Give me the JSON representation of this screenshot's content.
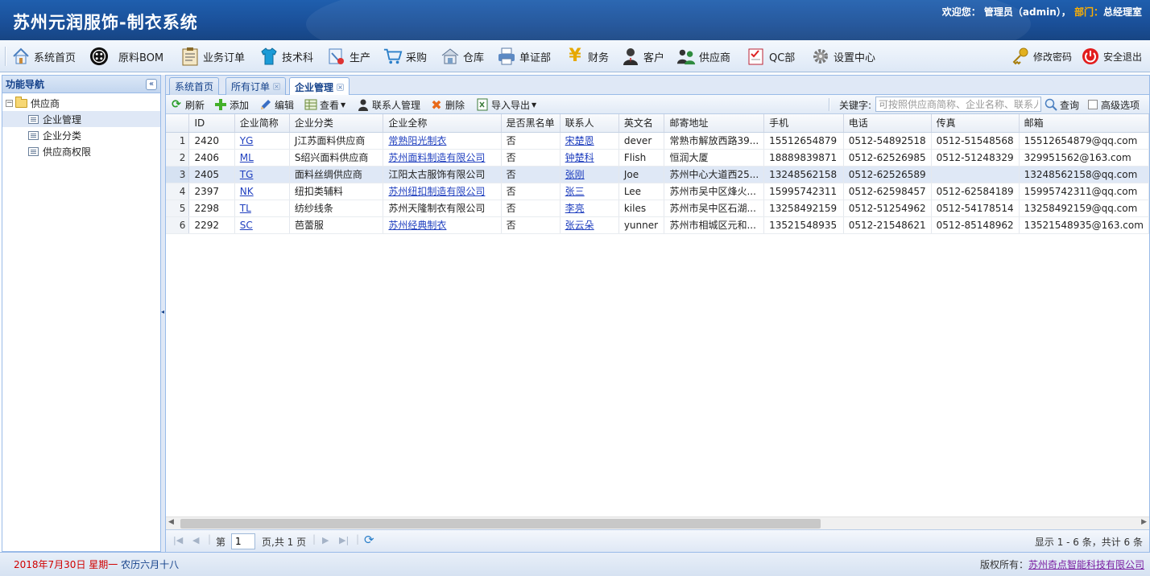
{
  "app": {
    "title": "苏州元润服饰-制衣系统",
    "welcome_prefix": "欢迎您：",
    "user": "管理员（admin），",
    "dept_label": "部门：",
    "dept": "总经理室"
  },
  "menu": {
    "items": [
      {
        "label": "系统首页",
        "icon": "home-icon"
      },
      {
        "label": "原料BOM",
        "icon": "button-icon"
      },
      {
        "label": "业务订单",
        "icon": "clipboard-icon"
      },
      {
        "label": "技术科",
        "icon": "shirt-icon"
      },
      {
        "label": "生产",
        "icon": "tools-icon"
      },
      {
        "label": "采购",
        "icon": "cart-icon"
      },
      {
        "label": "仓库",
        "icon": "warehouse-icon"
      },
      {
        "label": "单证部",
        "icon": "printer-icon"
      },
      {
        "label": "财务",
        "icon": "yen-icon"
      },
      {
        "label": "客户",
        "icon": "user-icon"
      },
      {
        "label": "供应商",
        "icon": "users-icon"
      },
      {
        "label": "QC部",
        "icon": "checklist-icon"
      },
      {
        "label": "设置中心",
        "icon": "gear-icon"
      }
    ],
    "change_password": "修改密码",
    "logout": "安全退出"
  },
  "nav": {
    "title": "功能导航",
    "root": "供应商",
    "items": [
      "企业管理",
      "企业分类",
      "供应商权限"
    ]
  },
  "tabs": [
    "系统首页",
    "所有订单",
    "企业管理"
  ],
  "toolbar": {
    "refresh": "刷新",
    "add": "添加",
    "edit": "编辑",
    "view": "查看",
    "contacts": "联系人管理",
    "delete": "删除",
    "import_export": "导入导出",
    "keyword_label": "关键字:",
    "search_placeholder": "可按照供应商简称、企业名称、联系人",
    "query": "查询",
    "advanced": "高级选项"
  },
  "grid": {
    "columns": [
      "ID",
      "企业简称",
      "企业分类",
      "企业全称",
      "是否黑名单",
      "联系人",
      "英文名",
      "邮寄地址",
      "手机",
      "电话",
      "传真",
      "邮箱"
    ],
    "rows": [
      {
        "n": "1",
        "id": "2420",
        "abbr": "YG",
        "category": "J江苏面料供应商",
        "full": "常熟阳光制衣",
        "full_link": true,
        "blacklist": "否",
        "contact": "宋楚恩",
        "en": "dever",
        "addr": "常熟市解放西路39...",
        "mobile": "15512654879",
        "phone": "0512-54892518",
        "fax": "0512-51548568",
        "email": "15512654879@qq.com"
      },
      {
        "n": "2",
        "id": "2406",
        "abbr": "ML",
        "category": "S绍兴面料供应商",
        "full": "苏州面料制造有限公司",
        "full_link": true,
        "blacklist": "否",
        "contact": "钟楚科",
        "en": "Flish",
        "addr": "恒润大厦",
        "mobile": "18889839871",
        "phone": "0512-62526985",
        "fax": "0512-51248329",
        "email": "329951562@163.com"
      },
      {
        "n": "3",
        "id": "2405",
        "abbr": "TG",
        "category": "面料丝绸供应商",
        "full": "江阳太古服饰有限公司",
        "full_link": false,
        "blacklist": "否",
        "contact": "张刚",
        "en": "Joe",
        "addr": "苏州中心大道西25...",
        "mobile": "13248562158",
        "phone": "0512-62526589",
        "fax": "",
        "email": "13248562158@qq.com"
      },
      {
        "n": "4",
        "id": "2397",
        "abbr": "NK",
        "category": "纽扣类辅料",
        "full": "苏州纽扣制造有限公司",
        "full_link": true,
        "blacklist": "否",
        "contact": "张三",
        "en": "Lee",
        "addr": "苏州市吴中区烽火...",
        "mobile": "15995742311",
        "phone": "0512-62598457",
        "fax": "0512-62584189",
        "email": "15995742311@qq.com"
      },
      {
        "n": "5",
        "id": "2298",
        "abbr": "TL",
        "category": "纺纱线条",
        "full": "苏州天隆制衣有限公司",
        "full_link": false,
        "blacklist": "否",
        "contact": "李亮",
        "en": "kiles",
        "addr": "苏州市吴中区石湖...",
        "mobile": "13258492159",
        "phone": "0512-51254962",
        "fax": "0512-54178514",
        "email": "13258492159@qq.com"
      },
      {
        "n": "6",
        "id": "2292",
        "abbr": "SC",
        "category": "芭蕾服",
        "full": "苏州经典制衣",
        "full_link": true,
        "blacklist": "否",
        "contact": "张云朵",
        "en": "yunner",
        "addr": "苏州市相城区元和...",
        "mobile": "13521548935",
        "phone": "0512-21548621",
        "fax": "0512-85148962",
        "email": "13521548935@163.com"
      }
    ]
  },
  "pager": {
    "page_prefix": "第",
    "page_value": "1",
    "page_suffix": "页,共 1 页",
    "summary": "显示 1 - 6 条，共计 6 条"
  },
  "footer": {
    "date": "2018年7月30日 星期一",
    "lunar": "农历六月十八",
    "copyright_label": "版权所有：",
    "company": "苏州奇点智能科技有限公司"
  },
  "colors": {
    "header_bg": "#1a4f98",
    "dept_label": "#ffb000",
    "selected_row": "#dfe8f6",
    "link": "#1f3fbf",
    "date_red": "#d00000"
  }
}
